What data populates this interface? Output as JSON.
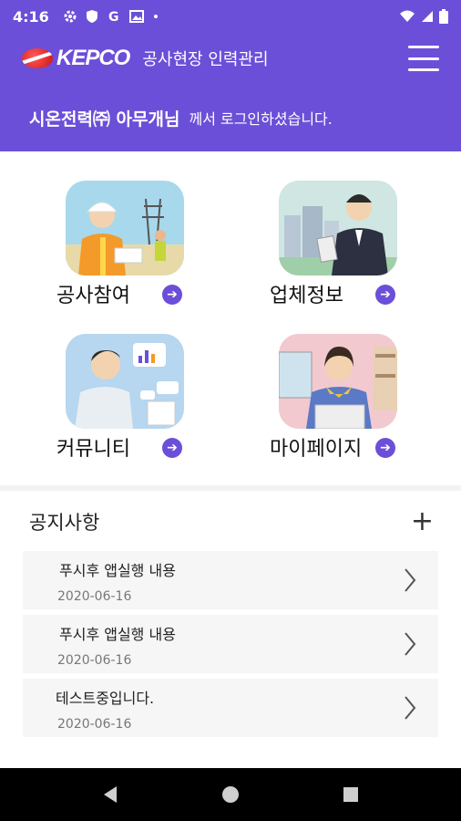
{
  "status_bar": {
    "time": "4:16"
  },
  "app_bar": {
    "logo_text": "KEPCO",
    "title": "공사현장 인력관리"
  },
  "welcome": {
    "user": "시온전력㈜ 아무개님",
    "message": "께서 로그인하셨습니다."
  },
  "menu_tiles": [
    {
      "label": "공사참여",
      "icon": "construction-worker-icon"
    },
    {
      "label": "업체정보",
      "icon": "businessman-icon"
    },
    {
      "label": "커뮤니티",
      "icon": "community-chat-icon"
    },
    {
      "label": "마이페이지",
      "icon": "mypage-user-icon"
    }
  ],
  "notices": {
    "header": "공지사항",
    "items": [
      {
        "title": "푸시후 앱실행 내용",
        "date": "2020-06-16"
      },
      {
        "title": "푸시후 앱실행 내용",
        "date": "2020-06-16"
      },
      {
        "title": "테스트중입니다.",
        "date": "2020-06-16"
      }
    ]
  },
  "colors": {
    "primary": "#6b4fd8",
    "list_bg": "#f6f6f6"
  }
}
